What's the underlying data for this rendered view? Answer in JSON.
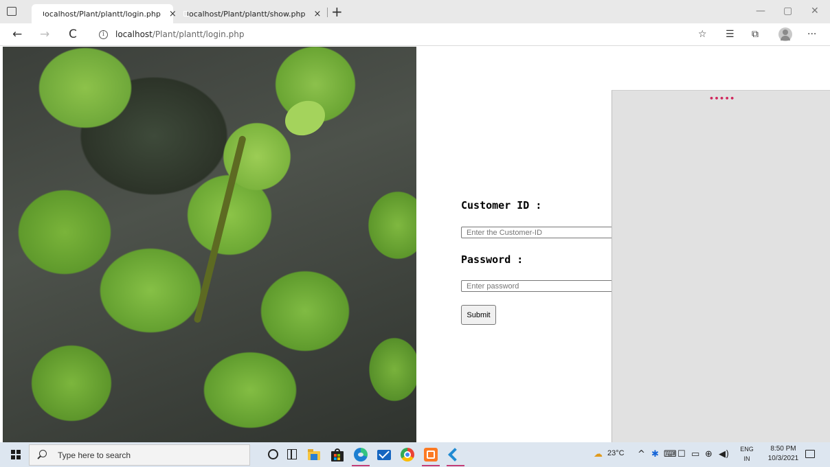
{
  "browser": {
    "tabs": [
      {
        "title": "localhost/Plant/plantt/login.php",
        "close": "×",
        "active": true
      },
      {
        "title": "localhost/Plant/plantt/show.php",
        "close": "×",
        "active": false
      }
    ],
    "new_tab": "+",
    "window_controls": {
      "minimize": "—",
      "restore": "▢",
      "close": "✕"
    },
    "nav": {
      "back": "←",
      "forward": "→",
      "reload": "C"
    },
    "url_host": "localhost",
    "url_path": "/Plant/plantt/login.php",
    "toolbar_icons": {
      "favorite": "☆",
      "favorites_list": "☰",
      "collections": "⧉",
      "more": "···"
    }
  },
  "page": {
    "customer_label": "Customer ID :",
    "customer_placeholder": "Enter the Customer-ID",
    "password_label": "Password :",
    "password_placeholder": "Enter password",
    "submit_label": "Submit",
    "overlay_dots": "•••••"
  },
  "taskbar": {
    "search_placeholder": "Type here to search",
    "weather": "23°C",
    "tray_chevron": "^",
    "language_top": "ENG",
    "language_bottom": "IN",
    "time": "8:50 PM",
    "date": "10/3/2021"
  },
  "colors": {
    "accent_underline": "#c43c75",
    "overlay": "#e1e1e1",
    "overlay_dots": "#d0275c"
  }
}
